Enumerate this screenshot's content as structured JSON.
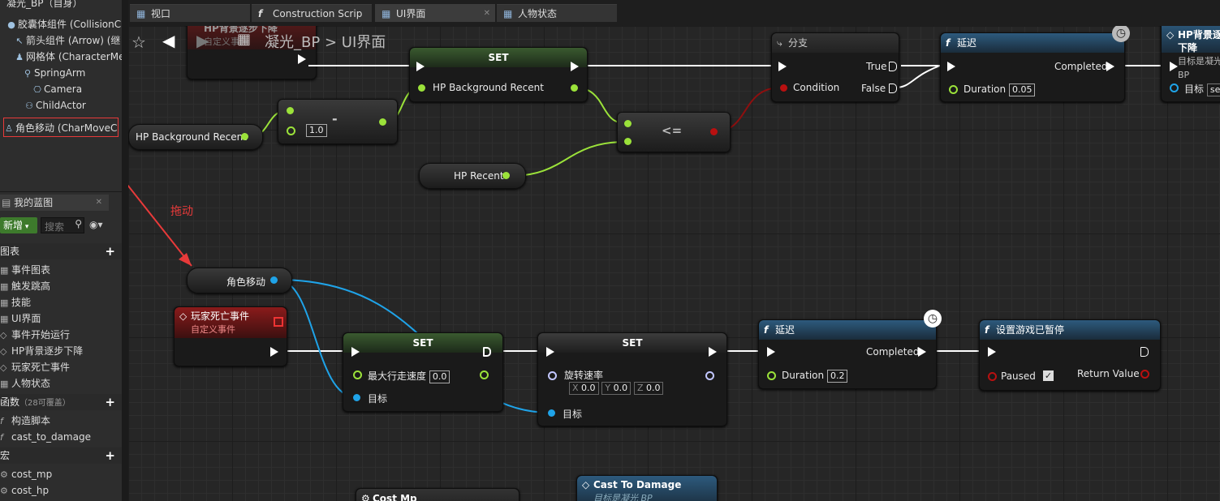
{
  "components": {
    "title": "凝光_BP（自身）",
    "items": [
      {
        "label": "胶囊体组件 (CollisionC",
        "icon": "capsule-icon"
      },
      {
        "label": "箭头组件 (Arrow) (继",
        "icon": "arrow-icon"
      },
      {
        "label": "网格体 (CharacterMe",
        "icon": "mesh-icon"
      },
      {
        "label": "SpringArm",
        "icon": "springarm-icon"
      },
      {
        "label": "Camera",
        "icon": "camera-icon"
      },
      {
        "label": "ChildActor",
        "icon": "actor-icon"
      },
      {
        "label": "角色移动 (CharMoveCo",
        "icon": "movement-icon"
      }
    ]
  },
  "annotation": {
    "label": "拖动",
    "color": "#e83a3a"
  },
  "myblueprint": {
    "tab_label": "我的蓝图",
    "new_button": "新增",
    "search_placeholder": "搜索",
    "graphs_header": "图表",
    "graphs": [
      "事件图表",
      "触发跳高",
      "技能",
      "UI界面",
      "事件开始运行",
      "HP背景逐步下降",
      "玩家死亡事件",
      "人物状态"
    ],
    "functions_header": "函数",
    "functions_note": "（28可覆盖）",
    "functions": [
      "构造脚本",
      "cast_to_damage"
    ],
    "macros_header": "宏",
    "macros": [
      "cost_mp",
      "cost_hp"
    ]
  },
  "tabs": [
    {
      "label": "视口",
      "icon": "viewport-icon"
    },
    {
      "label": "Construction Scrip",
      "icon": "function-icon"
    },
    {
      "label": "UI界面",
      "icon": "graph-icon"
    },
    {
      "label": "人物状态",
      "icon": "graph-icon"
    }
  ],
  "breadcrumb": {
    "blueprint": "凝光_BP",
    "separator": ">",
    "graph": "UI界面"
  },
  "nodes": {
    "hp_bg_top": {
      "title": "HP背景逐步下降",
      "subtitle": "自定义事件"
    },
    "set1": {
      "title": "SET",
      "pin": "HP Background Recent"
    },
    "minus": {
      "op": "-",
      "value": "1.0"
    },
    "hp_bg_var": {
      "label": "HP Background Recent"
    },
    "hp_recent_var": {
      "label": "HP Recent"
    },
    "compare": {
      "op": "<="
    },
    "branch": {
      "title": "分支",
      "true_label": "True",
      "false_label": "False",
      "condition": "Condition"
    },
    "delay1": {
      "title": "延迟",
      "completed": "Completed",
      "duration_label": "Duration",
      "duration": "0.05"
    },
    "hp_bg_right": {
      "title": "HP背景逐步下降",
      "sub": "目标是凝光 BP",
      "target": "目标",
      "target_value": "se"
    },
    "move_var": {
      "label": "角色移动"
    },
    "death_event": {
      "title": "玩家死亡事件",
      "subtitle": "自定义事件"
    },
    "set2": {
      "title": "SET",
      "pin": "最大行走速度",
      "value": "0.0",
      "target": "目标"
    },
    "set3": {
      "title": "SET",
      "pin": "旋转速率",
      "x_label": "X",
      "x": "0.0",
      "y_label": "Y",
      "y": "0.0",
      "z_label": "Z",
      "z": "0.0",
      "target": "目标"
    },
    "delay2": {
      "title": "延迟",
      "completed": "Completed",
      "duration_label": "Duration",
      "duration": "0.2"
    },
    "pause": {
      "title": "设置游戏已暂停",
      "paused": "Paused",
      "return": "Return Value"
    },
    "cost_mp": {
      "title": "Cost Mp"
    },
    "cast_damage": {
      "title": "Cast To Damage",
      "sub": "目标是凝光 BP"
    }
  },
  "colors": {
    "exec": "#ffffff",
    "float": "#9be23a",
    "object": "#1fa3e8",
    "bool": "#8e0f0f",
    "vector": "#c2c7ff",
    "annotation": "#e83a3a"
  }
}
